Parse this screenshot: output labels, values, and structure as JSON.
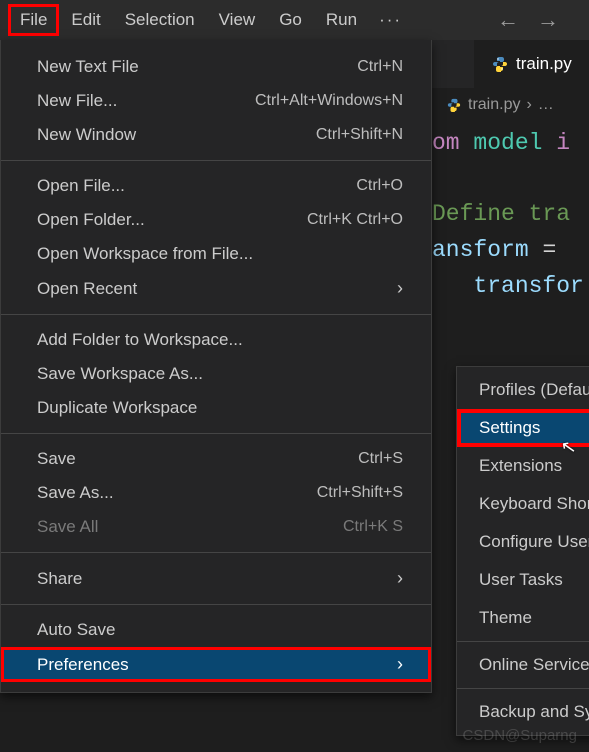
{
  "menubar": {
    "items": [
      "File",
      "Edit",
      "Selection",
      "View",
      "Go",
      "Run"
    ],
    "more": "···",
    "nav_back": "←",
    "nav_forward": "→"
  },
  "dropdown": {
    "groups": [
      [
        {
          "label": "New Text File",
          "shortcut": "Ctrl+N"
        },
        {
          "label": "New File...",
          "shortcut": "Ctrl+Alt+Windows+N"
        },
        {
          "label": "New Window",
          "shortcut": "Ctrl+Shift+N"
        }
      ],
      [
        {
          "label": "Open File...",
          "shortcut": "Ctrl+O"
        },
        {
          "label": "Open Folder...",
          "shortcut": "Ctrl+K Ctrl+O"
        },
        {
          "label": "Open Workspace from File..."
        },
        {
          "label": "Open Recent",
          "submenu": true
        }
      ],
      [
        {
          "label": "Add Folder to Workspace..."
        },
        {
          "label": "Save Workspace As..."
        },
        {
          "label": "Duplicate Workspace"
        }
      ],
      [
        {
          "label": "Save",
          "shortcut": "Ctrl+S"
        },
        {
          "label": "Save As...",
          "shortcut": "Ctrl+Shift+S"
        },
        {
          "label": "Save All",
          "shortcut": "Ctrl+K S",
          "disabled": true
        }
      ],
      [
        {
          "label": "Share",
          "submenu": true
        }
      ],
      [
        {
          "label": "Auto Save"
        },
        {
          "label": "Preferences",
          "submenu": true,
          "hover": true,
          "red_highlight": true
        }
      ]
    ]
  },
  "submenu_preferences": {
    "groups": [
      [
        {
          "label": "Profiles (Default)"
        },
        {
          "label": "Settings",
          "hover": true,
          "red_highlight": true
        },
        {
          "label": "Extensions"
        },
        {
          "label": "Keyboard Shortcuts"
        },
        {
          "label": "Configure User Snippets"
        },
        {
          "label": "User Tasks"
        },
        {
          "label": "Theme"
        }
      ],
      [
        {
          "label": "Online Services Settings"
        }
      ],
      [
        {
          "label": "Backup and Sync Settings"
        }
      ]
    ]
  },
  "editor": {
    "tab_name": "train.py",
    "breadcrumb_file": "train.py",
    "breadcrumb_more": "…",
    "code_tokens": {
      "from": "om",
      "module": "model",
      "import_kw": "i",
      "comment": "Define tra",
      "var": "ansform",
      "eq": "=",
      "call": "transfor"
    }
  },
  "watermark": "CSDN@Suparng",
  "highlight_color": "#ff0000"
}
